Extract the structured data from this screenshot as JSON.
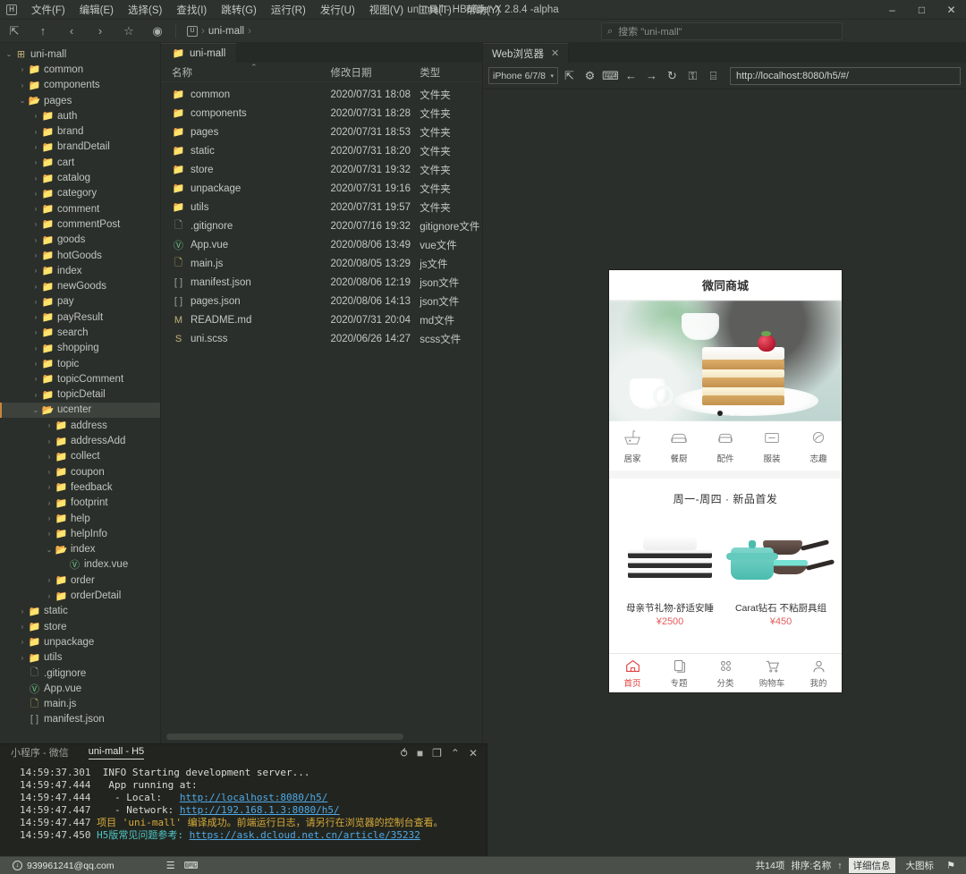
{
  "window": {
    "title": "uni-mall - HBuilder X 2.8.4 -alpha",
    "logo": "H",
    "minimize": "–",
    "maximize": "□",
    "close": "✕"
  },
  "menubar": {
    "items": [
      {
        "label": "文件(F)"
      },
      {
        "label": "编辑(E)"
      },
      {
        "label": "选择(S)"
      },
      {
        "label": "查找(I)"
      },
      {
        "label": "跳转(G)"
      },
      {
        "label": "运行(R)"
      },
      {
        "label": "发行(U)"
      },
      {
        "label": "视图(V)"
      },
      {
        "label": "工具(T)"
      },
      {
        "label": "帮助(Y)"
      }
    ]
  },
  "toolbar": {
    "icons": [
      {
        "name": "new-window-icon",
        "glyph": "⇱"
      },
      {
        "name": "up-arrow-icon",
        "glyph": "↑"
      },
      {
        "name": "back-arrow-icon",
        "glyph": "‹"
      },
      {
        "name": "forward-arrow-icon",
        "glyph": "›"
      },
      {
        "name": "star-icon",
        "glyph": "☆"
      },
      {
        "name": "run-icon",
        "glyph": "◉"
      }
    ],
    "breadcrumb": {
      "root_glyph": "U",
      "label": "uni-mall",
      "sep": "›",
      "trailing_sep": "›"
    },
    "search": {
      "icon": "⌕",
      "placeholder": "搜索 \"uni-mall\"",
      "value": "搜索 \"uni-mall\""
    }
  },
  "sidebar": {
    "items": [
      {
        "label": "uni-mall",
        "depth": 0,
        "arrow": "⌄",
        "icon": "root",
        "selected": false
      },
      {
        "label": "common",
        "depth": 1,
        "arrow": "›",
        "icon": "folder",
        "selected": false
      },
      {
        "label": "components",
        "depth": 1,
        "arrow": "›",
        "icon": "folder",
        "selected": false
      },
      {
        "label": "pages",
        "depth": 1,
        "arrow": "⌄",
        "icon": "folder-open",
        "selected": false
      },
      {
        "label": "auth",
        "depth": 2,
        "arrow": "›",
        "icon": "folder",
        "selected": false
      },
      {
        "label": "brand",
        "depth": 2,
        "arrow": "›",
        "icon": "folder",
        "selected": false
      },
      {
        "label": "brandDetail",
        "depth": 2,
        "arrow": "›",
        "icon": "folder",
        "selected": false
      },
      {
        "label": "cart",
        "depth": 2,
        "arrow": "›",
        "icon": "folder",
        "selected": false
      },
      {
        "label": "catalog",
        "depth": 2,
        "arrow": "›",
        "icon": "folder",
        "selected": false
      },
      {
        "label": "category",
        "depth": 2,
        "arrow": "›",
        "icon": "folder",
        "selected": false
      },
      {
        "label": "comment",
        "depth": 2,
        "arrow": "›",
        "icon": "folder",
        "selected": false
      },
      {
        "label": "commentPost",
        "depth": 2,
        "arrow": "›",
        "icon": "folder",
        "selected": false
      },
      {
        "label": "goods",
        "depth": 2,
        "arrow": "›",
        "icon": "folder",
        "selected": false
      },
      {
        "label": "hotGoods",
        "depth": 2,
        "arrow": "›",
        "icon": "folder",
        "selected": false
      },
      {
        "label": "index",
        "depth": 2,
        "arrow": "›",
        "icon": "folder",
        "selected": false
      },
      {
        "label": "newGoods",
        "depth": 2,
        "arrow": "›",
        "icon": "folder",
        "selected": false
      },
      {
        "label": "pay",
        "depth": 2,
        "arrow": "›",
        "icon": "folder",
        "selected": false
      },
      {
        "label": "payResult",
        "depth": 2,
        "arrow": "›",
        "icon": "folder",
        "selected": false
      },
      {
        "label": "search",
        "depth": 2,
        "arrow": "›",
        "icon": "folder",
        "selected": false
      },
      {
        "label": "shopping",
        "depth": 2,
        "arrow": "›",
        "icon": "folder",
        "selected": false
      },
      {
        "label": "topic",
        "depth": 2,
        "arrow": "›",
        "icon": "folder",
        "selected": false
      },
      {
        "label": "topicComment",
        "depth": 2,
        "arrow": "›",
        "icon": "folder",
        "selected": false
      },
      {
        "label": "topicDetail",
        "depth": 2,
        "arrow": "›",
        "icon": "folder",
        "selected": false
      },
      {
        "label": "ucenter",
        "depth": 2,
        "arrow": "⌄",
        "icon": "folder-open",
        "selected": true
      },
      {
        "label": "address",
        "depth": 3,
        "arrow": "›",
        "icon": "folder",
        "selected": false
      },
      {
        "label": "addressAdd",
        "depth": 3,
        "arrow": "›",
        "icon": "folder",
        "selected": false
      },
      {
        "label": "collect",
        "depth": 3,
        "arrow": "›",
        "icon": "folder",
        "selected": false
      },
      {
        "label": "coupon",
        "depth": 3,
        "arrow": "›",
        "icon": "folder",
        "selected": false
      },
      {
        "label": "feedback",
        "depth": 3,
        "arrow": "›",
        "icon": "folder",
        "selected": false
      },
      {
        "label": "footprint",
        "depth": 3,
        "arrow": "›",
        "icon": "folder",
        "selected": false
      },
      {
        "label": "help",
        "depth": 3,
        "arrow": "›",
        "icon": "folder",
        "selected": false
      },
      {
        "label": "helpInfo",
        "depth": 3,
        "arrow": "›",
        "icon": "folder",
        "selected": false
      },
      {
        "label": "index",
        "depth": 3,
        "arrow": "⌄",
        "icon": "folder-open",
        "selected": false
      },
      {
        "label": "index.vue",
        "depth": 4,
        "arrow": "",
        "icon": "vue",
        "selected": false
      },
      {
        "label": "order",
        "depth": 3,
        "arrow": "›",
        "icon": "folder",
        "selected": false
      },
      {
        "label": "orderDetail",
        "depth": 3,
        "arrow": "›",
        "icon": "folder",
        "selected": false
      },
      {
        "label": "static",
        "depth": 1,
        "arrow": "›",
        "icon": "folder",
        "selected": false
      },
      {
        "label": "store",
        "depth": 1,
        "arrow": "›",
        "icon": "folder",
        "selected": false
      },
      {
        "label": "unpackage",
        "depth": 1,
        "arrow": "›",
        "icon": "folder",
        "selected": false
      },
      {
        "label": "utils",
        "depth": 1,
        "arrow": "›",
        "icon": "folder",
        "selected": false
      },
      {
        "label": ".gitignore",
        "depth": 1,
        "arrow": "",
        "icon": "doc",
        "selected": false
      },
      {
        "label": "App.vue",
        "depth": 1,
        "arrow": "",
        "icon": "vue",
        "selected": false
      },
      {
        "label": "main.js",
        "depth": 1,
        "arrow": "",
        "icon": "js",
        "selected": false
      },
      {
        "label": "manifest.json",
        "depth": 1,
        "arrow": "",
        "icon": "json",
        "selected": false
      }
    ]
  },
  "filepane": {
    "tab": {
      "label": "uni-mall",
      "icon": "folder-icon"
    },
    "columns": {
      "name": "名称",
      "date": "修改日期",
      "type": "类型",
      "sort_caret": "⌃"
    },
    "rows": [
      {
        "name": "common",
        "date": "2020/07/31 18:08",
        "type": "文件夹",
        "icon": "folder"
      },
      {
        "name": "components",
        "date": "2020/07/31 18:28",
        "type": "文件夹",
        "icon": "folder"
      },
      {
        "name": "pages",
        "date": "2020/07/31 18:53",
        "type": "文件夹",
        "icon": "folder"
      },
      {
        "name": "static",
        "date": "2020/07/31 18:20",
        "type": "文件夹",
        "icon": "folder"
      },
      {
        "name": "store",
        "date": "2020/07/31 19:32",
        "type": "文件夹",
        "icon": "folder"
      },
      {
        "name": "unpackage",
        "date": "2020/07/31 19:16",
        "type": "文件夹",
        "icon": "folder"
      },
      {
        "name": "utils",
        "date": "2020/07/31 19:57",
        "type": "文件夹",
        "icon": "folder"
      },
      {
        "name": ".gitignore",
        "date": "2020/07/16 19:32",
        "type": "gitignore文件",
        "icon": "doc"
      },
      {
        "name": "App.vue",
        "date": "2020/08/06 13:49",
        "type": "vue文件",
        "icon": "vue"
      },
      {
        "name": "main.js",
        "date": "2020/08/05 13:29",
        "type": "js文件",
        "icon": "js"
      },
      {
        "name": "manifest.json",
        "date": "2020/08/06 12:19",
        "type": "json文件",
        "icon": "json"
      },
      {
        "name": "pages.json",
        "date": "2020/08/06 14:13",
        "type": "json文件",
        "icon": "json"
      },
      {
        "name": "README.md",
        "date": "2020/07/31 20:04",
        "type": "md文件",
        "icon": "md"
      },
      {
        "name": "uni.scss",
        "date": "2020/06/26 14:27",
        "type": "scss文件",
        "icon": "scss"
      }
    ]
  },
  "browser": {
    "tab": {
      "label": "Web浏览器",
      "close": "✕"
    },
    "device": {
      "value": "iPhone 6/7/8",
      "caret": "▾"
    },
    "icons": [
      {
        "name": "open-external-icon",
        "glyph": "⇱"
      },
      {
        "name": "settings-gear-icon",
        "glyph": "⚙"
      },
      {
        "name": "console-icon",
        "glyph": "⌨"
      },
      {
        "name": "back-icon",
        "glyph": "←"
      },
      {
        "name": "forward-icon",
        "glyph": "→"
      },
      {
        "name": "reload-icon",
        "glyph": "↻"
      },
      {
        "name": "lock-icon",
        "glyph": "⚿"
      },
      {
        "name": "qrcode-icon",
        "glyph": "⌸"
      }
    ],
    "url": "http://localhost:8080/h5/#/"
  },
  "preview": {
    "header_title": "微同商城",
    "carousel": {
      "slides": 2,
      "active": 0
    },
    "categories": [
      {
        "label": "居家",
        "icon": "home-goods-icon"
      },
      {
        "label": "餐厨",
        "icon": "kitchen-icon"
      },
      {
        "label": "配件",
        "icon": "accessory-icon"
      },
      {
        "label": "服装",
        "icon": "clothing-icon"
      },
      {
        "label": "志趣",
        "icon": "hobby-icon"
      }
    ],
    "section_title": "周一-周四 · 新品首发",
    "products": [
      {
        "title": "母亲节礼物-舒适安睡",
        "price": "¥2500",
        "image": "pillow"
      },
      {
        "title": "Carat钻石 不粘厨具组",
        "price": "¥450",
        "image": "cookware"
      }
    ],
    "tabbar": [
      {
        "label": "首页",
        "icon": "home-icon",
        "active": true
      },
      {
        "label": "专题",
        "icon": "topic-icon",
        "active": false
      },
      {
        "label": "分类",
        "icon": "category-icon",
        "active": false
      },
      {
        "label": "购物车",
        "icon": "cart-icon",
        "active": false
      },
      {
        "label": "我的",
        "icon": "user-icon",
        "active": false
      }
    ],
    "accent_color": "#e23e3e",
    "price_color": "#e35c5c"
  },
  "console": {
    "tabs": [
      {
        "label": "小程序 - 微信",
        "active": false
      },
      {
        "label": "uni-mall - H5",
        "active": true
      }
    ],
    "tools": [
      {
        "name": "rerun-icon",
        "glyph": "⥀"
      },
      {
        "name": "stop-icon",
        "glyph": "■"
      },
      {
        "name": "open-console-icon",
        "glyph": "❐"
      },
      {
        "name": "collapse-icon",
        "glyph": "⌃"
      },
      {
        "name": "clear-icon",
        "glyph": "✕"
      }
    ],
    "lines": [
      {
        "time": "14:59:37.301",
        "level": "INFO",
        "text": "Starting development server...",
        "style": "plain"
      },
      {
        "time": "14:59:47.444",
        "level": "",
        "text": "  App running at:",
        "style": "plain"
      },
      {
        "time": "14:59:47.444",
        "level": "",
        "text": "   - Local:   ",
        "link": "http://localhost:8080/h5/",
        "style": "link"
      },
      {
        "time": "14:59:47.447",
        "level": "",
        "text": "   - Network: ",
        "link": "http://192.168.1.3:8080/h5/",
        "style": "link"
      },
      {
        "time": "14:59:47.447",
        "level": "",
        "text": "项目 'uni-mall' 编译成功。前端运行日志，请另行在浏览器的控制台查看。",
        "style": "warn"
      },
      {
        "time": "14:59:47.450",
        "level": "",
        "text": "H5版常见问题参考: ",
        "link": "https://ask.dcloud.net.cn/article/35232",
        "style": "cyan-link"
      }
    ]
  },
  "statusbar": {
    "user": "939961241@qq.com",
    "user_icon": "↓",
    "icons": [
      {
        "name": "outline-icon",
        "glyph": "☰"
      },
      {
        "name": "terminal-icon",
        "glyph": "⌨"
      }
    ],
    "count": "共14项",
    "sort": "排序:名称",
    "sort_arrow": "↑",
    "view_detail": "详细信息",
    "view_large": "大图标",
    "bell": "⚑"
  }
}
